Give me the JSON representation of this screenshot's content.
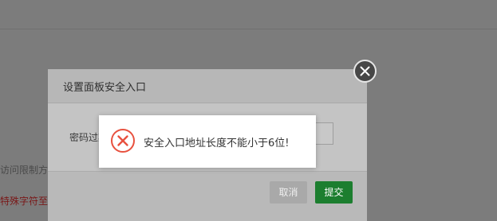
{
  "background": {
    "access_limit_text": "访问限制方式",
    "special_char_text": "特殊字符至少"
  },
  "dialog": {
    "title": "设置面板安全入口",
    "field_label": "密码过期",
    "cancel_label": "取消",
    "submit_label": "提交"
  },
  "alert": {
    "message": "安全入口地址长度不能小于6位!",
    "icon": "error-x-circle-icon",
    "icon_color": "#e8513f"
  },
  "colors": {
    "submit": "#1c7e2f",
    "close_button": "#474747"
  }
}
